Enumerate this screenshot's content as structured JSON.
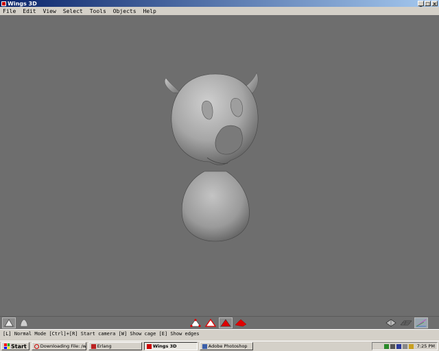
{
  "window": {
    "title": "Wings 3D"
  },
  "window_buttons": [
    "_",
    "□",
    "×"
  ],
  "menu": [
    "File",
    "Edit",
    "View",
    "Select",
    "Tools",
    "Objects",
    "Help"
  ],
  "status": {
    "text": "[L] Normal Mode [Ctrl]+[R] Start camera  [W] Show cage  [E] Show edges"
  },
  "toolbar": {
    "left_tools": [
      "smooth-shaded-icon",
      "workmode-icon"
    ],
    "select_modes": [
      "vertex-mode-icon",
      "edge-mode-icon",
      "face-mode-icon",
      "body-mode-icon"
    ],
    "selected_mode": "face-mode-icon",
    "right_tools": [
      "wireframe-toggle-icon",
      "ground-plane-icon",
      "perspective-icon"
    ]
  },
  "taskbar": {
    "start_label": "Start",
    "tasks": [
      {
        "label": "Downloading File: /wings/...",
        "icon": "opera-icon"
      },
      {
        "label": "Erlang",
        "icon": "erlang-icon"
      },
      {
        "label": "Wings 3D",
        "icon": "wings-icon",
        "active": true
      },
      {
        "label": "Adobe Photoshop",
        "icon": "photoshop-icon"
      }
    ],
    "clock": "7:25 PM"
  },
  "colors": {
    "viewport_bg": "#6e6e6e",
    "chrome": "#d4d0c8",
    "selection_red": "#e00000"
  }
}
